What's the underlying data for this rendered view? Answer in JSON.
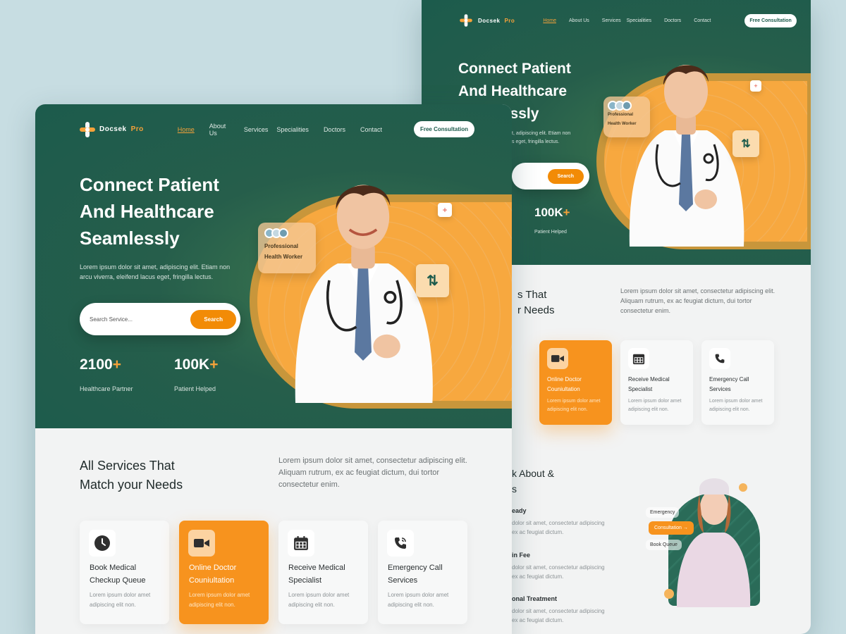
{
  "brand": {
    "name": "Docsek",
    "suffix": "Pro"
  },
  "nav": {
    "items": [
      "Home",
      "About Us",
      "Services",
      "Specialities",
      "Doctors",
      "Contact"
    ],
    "cta": "Free Consultation"
  },
  "hero": {
    "title": "Connect Patient And Healthcare Seamlessly",
    "description": "Lorem ipsum dolor sit amet, adipiscing elit. Etiam non arcu viverra, eleifend lacus eget, fringilla lectus.",
    "search_placeholder": "Search Service...",
    "search_button": "Search",
    "stats": [
      {
        "value": "2100",
        "suffix": "+",
        "label": "Healthcare Partner"
      },
      {
        "value": "100K",
        "suffix": "+",
        "label": "Patient Helped"
      }
    ],
    "badge": {
      "line1": "Professional",
      "line2": "Health Worker"
    },
    "plus_glyph": "+",
    "arrows_glyph": "⇅"
  },
  "services": {
    "title_line1": "All Services That",
    "title_line2": "Match your Needs",
    "description": "Lorem ipsum dolor sit amet, consectetur adipiscing elit. Aliquam rutrum, ex ac feugiat dictum, dui tortor consectetur enim.",
    "cards": [
      {
        "title_line1": "Book Medical",
        "title_line2": "Checkup Queue",
        "desc_line1": "Lorem ipsum dolor amet",
        "desc_line2": "adipiscing elit non.",
        "icon": "clock-icon"
      },
      {
        "title_line1": "Online Doctor",
        "title_line2": "Couniultation",
        "desc_line1": "Lorem ipsum dolor amet",
        "desc_line2": "adipiscing elit non.",
        "icon": "video-icon"
      },
      {
        "title_line1": "Receive Medical",
        "title_line2": "Specialist",
        "desc_line1": "Lorem ipsum dolor amet",
        "desc_line2": "adipiscing elit non.",
        "icon": "calendar-icon"
      },
      {
        "title_line1": "Emergency Call",
        "title_line2": "Services",
        "desc_line1": "Lorem ipsum dolor amet",
        "desc_line2": "adipiscing elit non.",
        "icon": "phone-icon"
      }
    ]
  },
  "back_page": {
    "partial_title_line1": "s That",
    "partial_title_line2": "r Needs",
    "partial_hero_line3": "lessly",
    "partial_desc_line1": "t, adipiscing elit. Etiam non",
    "partial_desc_line2": "s eget, fringilla lectus.",
    "about_title_line1": "k About &",
    "about_title_line2": "s",
    "features": [
      {
        "title": "eady",
        "desc_line1": "dolor sit amet, consectetur adipiscing",
        "desc_line2": "ex ac feugiat dictum."
      },
      {
        "title": "in Fee",
        "desc_line1": "dolor sit amet, consectetur adipiscing",
        "desc_line2": "ex ac feugiat dictum."
      },
      {
        "title": "onal Treatment",
        "desc_line1": "dolor sit amet, consectetur adipiscing",
        "desc_line2": "ex ac feugiat dictum."
      }
    ],
    "card_partial_desc_line1": "et",
    "card_partial_desc_line2": "",
    "menu": [
      "Emergency",
      "Consultation →",
      "Book Queue"
    ]
  },
  "colors": {
    "primary": "#1c5b4c",
    "accent": "#f7931e",
    "background": "#c7dde2"
  }
}
